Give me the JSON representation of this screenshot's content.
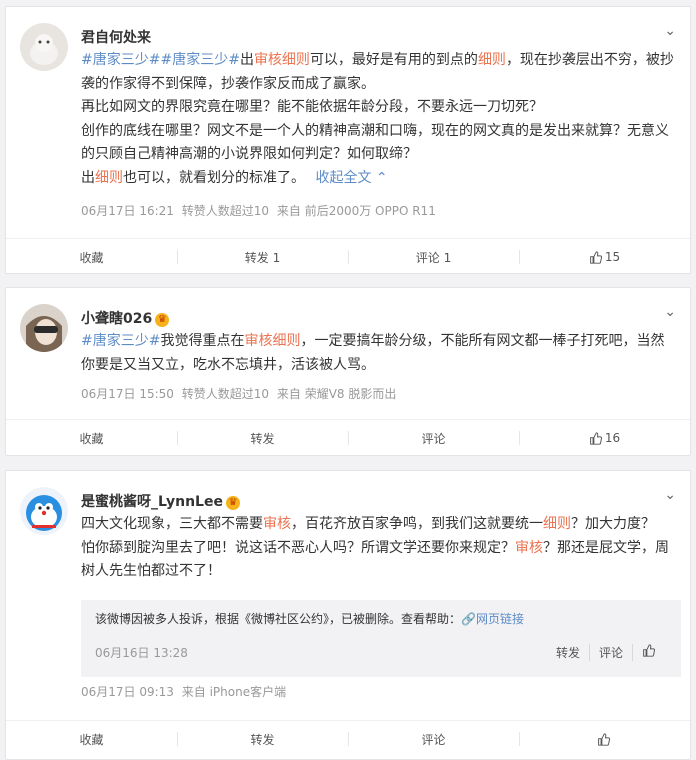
{
  "posts": [
    {
      "username": "君自何处来",
      "text_lines": [
        [
          "#唐家三少#",
          "#唐家三少#",
          "出",
          "审核细则",
          "可以，最好是有用的到点的",
          "细则",
          "，现在抄袭层出不穷，被抄"
        ],
        [
          "袭的作家得不到保障，抄袭作家反而成了赢家。"
        ],
        [
          "再比如网文的界限究竟在哪里？能不能依据年龄分段，不要永远一刀切死？"
        ],
        [
          "创作的底线在哪里？网文不是一个人的精神高潮和口嗨，现在的网文真的是发出来就算？无意义"
        ],
        [
          "的只顾自己精神高潮的小说界限如何判定？如何取缔？"
        ],
        [
          "出",
          "细则",
          "也可以，就看划分的标准了。",
          "收起全文"
        ]
      ],
      "collapse_label": "收起全文",
      "time": "06月17日 16:21",
      "repost_note": "转赞人数超过10",
      "source": "来自 前后2000万 OPPO R11",
      "actions": {
        "collect": "收藏",
        "repost": "转发 1",
        "comment": "评论 1",
        "like": "15"
      }
    },
    {
      "username": "小聋瞎026",
      "text_lines": [
        [
          "#唐家三少#",
          "我觉得重点在",
          "审核细则",
          "，一定要搞年龄分级，不能所有网文都一棒子打死吧，当然"
        ],
        [
          "你要是又当又立，吃水不忘填井，活该被人骂。"
        ]
      ],
      "time": "06月17日 15:50",
      "repost_note": "转赞人数超过10",
      "source": "来自 荣耀V8 脱影而出",
      "actions": {
        "collect": "收藏",
        "repost": "转发",
        "comment": "评论",
        "like": "16"
      }
    },
    {
      "username": "是蜜桃酱呀_LynnLee",
      "text_lines": [
        [
          "四大文化现象，三大都不需要",
          "审核",
          "，百花齐放百家争鸣，到我们这就要统一",
          "细则",
          "？加大力度？"
        ],
        [
          "怕你舔到腚沟里去了吧！说这话不恶心人吗？所谓文学还要你来规定？",
          "审核",
          "？那还是屁文学，周"
        ],
        [
          "树人先生怕都过不了！"
        ]
      ],
      "quote": {
        "text": "该微博因被多人投诉，根据《微博社区公约》，已被删除。查看帮助：",
        "link": "网页链接",
        "date": "06月16日 13:28",
        "repost": "转发",
        "comment": "评论"
      },
      "time": "06月17日 09:13",
      "source": "来自 iPhone客户端",
      "actions": {
        "collect": "收藏",
        "repost": "转发",
        "comment": "评论",
        "like": ""
      }
    }
  ],
  "colors": {
    "accent": "#eb7350",
    "link_blue": "#5d8cc6",
    "bg": "#f2f2f5"
  }
}
